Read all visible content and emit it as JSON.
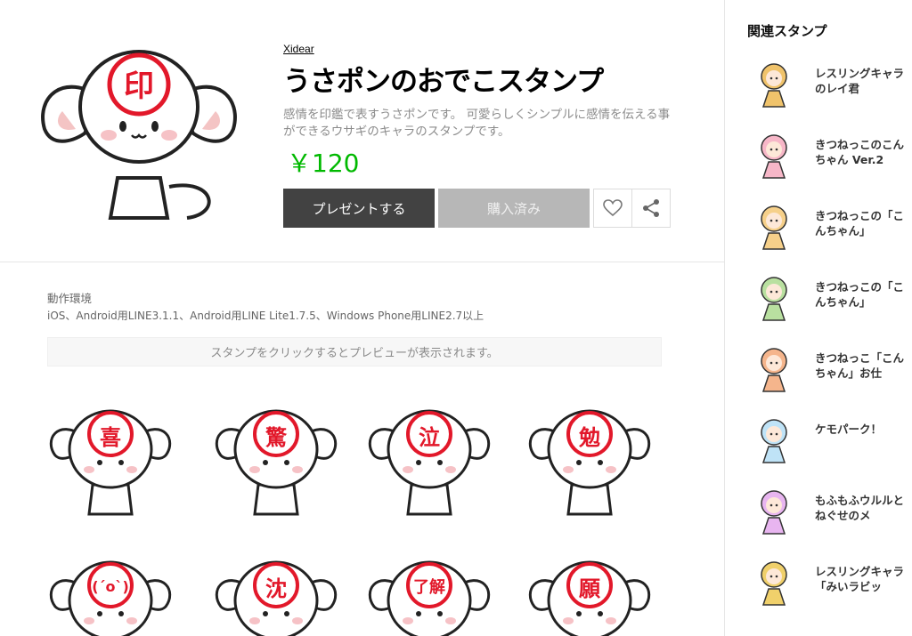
{
  "product": {
    "author": "Xidear",
    "title": "うさポンのおでこスタンプ",
    "description": "感情を印鑑で表すうさポンです。 可愛らしくシンプルに感情を伝える事ができるウサギのキャラのスタンプです。",
    "price": "￥120",
    "present_label": "プレゼントする",
    "purchased_label": "購入済み",
    "main_stamp_char": "印"
  },
  "environment": {
    "label": "動作環境",
    "text": "iOS、Android用LINE3.1.1、Android用LINE Lite1.7.5、Windows Phone用LINE2.7以上"
  },
  "preview_notice": "スタンプをクリックするとプレビューが表示されます。",
  "stickers": [
    "喜",
    "驚",
    "泣",
    "勉",
    "(´o`)",
    "沈",
    "了解",
    "願"
  ],
  "sidebar": {
    "title": "関連スタンプ",
    "items": [
      {
        "name": "レスリングキャラのレイ君"
      },
      {
        "name": "きつねっこのこんちゃん Ver.2"
      },
      {
        "name": "きつねっこの「こんちゃん」"
      },
      {
        "name": "きつねっこの「こんちゃん」"
      },
      {
        "name": "きつねっこ「こんちゃん」お仕"
      },
      {
        "name": "ケモパーク！"
      },
      {
        "name": "もふもふウルルとねぐせのメ"
      },
      {
        "name": "レスリングキャラ「みいラビッ"
      }
    ]
  },
  "colors": {
    "accent": "#00b900",
    "stamp_red": "#e2182a",
    "present_bg": "#424242"
  }
}
